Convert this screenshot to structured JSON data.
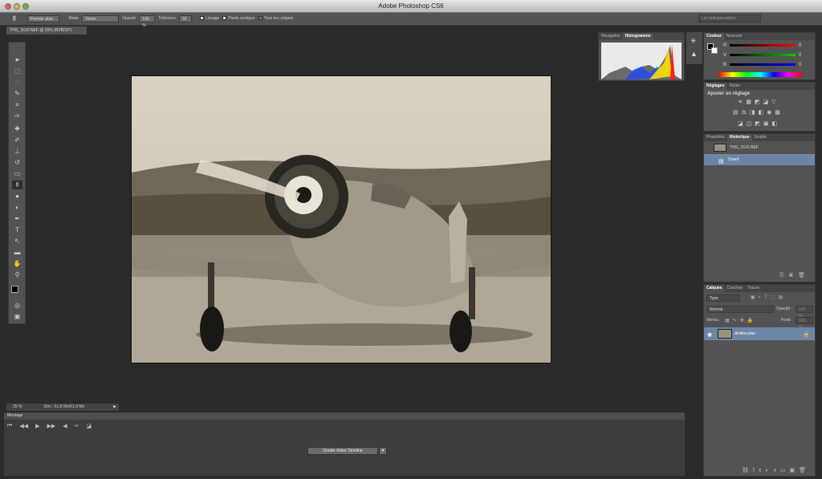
{
  "window": {
    "title": "Adobe Photoshop CS6"
  },
  "options_bar": {
    "preset_label": "Premier plan",
    "mode_label": "Mode",
    "mode_value": "Teinte",
    "opacity_label": "Opacité",
    "opacity_value": "100 %",
    "tolerance_label": "Tolérance",
    "tolerance_value": "32",
    "lissage_label": "Lissage",
    "pixels_contigus_label": "Pixels contigus",
    "tous_calques_label": "Tous les calques",
    "workspace_value": "Les indispensables"
  },
  "document": {
    "tab_label": "THG_1610.NEF @ 25% (RVB/16*)"
  },
  "status": {
    "zoom": "25 %",
    "doc": "Doc : 61,8 Mo/61,8 Mo"
  },
  "timeline": {
    "title": "Montage",
    "create_button": "Create Video Timeline"
  },
  "navigator_panel": {
    "tabs": [
      "Navigation",
      "Histogramme"
    ]
  },
  "colour_panel": {
    "tabs": [
      "Couleur",
      "Nuancier"
    ],
    "r": "0",
    "g": "0",
    "b": "0",
    "r_label": "R",
    "g_label": "V",
    "b_label": "B"
  },
  "adjust_panel": {
    "tabs": [
      "Réglages",
      "Styles"
    ],
    "heading": "Ajouter un réglage"
  },
  "history_panel": {
    "tabs": [
      "Propriétés",
      "Historique",
      "Scripts"
    ],
    "snapshot": "THG_1610.NEF",
    "items": [
      "Ouvrir"
    ]
  },
  "layers_panel": {
    "tabs": [
      "Calques",
      "Couches",
      "Tracés"
    ],
    "kind": "Type",
    "blend": "Normal",
    "opacity_label": "Opacité :",
    "opacity_value": "100 %",
    "lock_label": "Verrou :",
    "fill_label": "Fond :",
    "fill_value": "100 %",
    "layer_name": "Arrière-plan"
  },
  "colors": {
    "accent_selection": "#6d86a8",
    "panel": "#535353"
  }
}
